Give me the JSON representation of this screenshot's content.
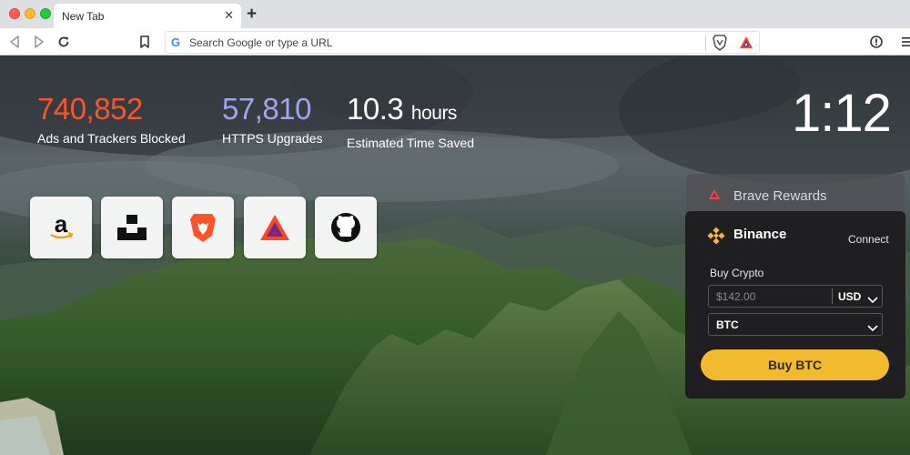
{
  "tab": {
    "title": "New Tab",
    "close": "✕",
    "new_tab": "+"
  },
  "toolbar": {
    "url_placeholder": "Search Google or type a URL",
    "google_glyph": "G"
  },
  "stats": [
    {
      "value": "740,852",
      "label": "Ads and Trackers Blocked",
      "color": "#fb542b"
    },
    {
      "value": "57,810",
      "label": "HTTPS Upgrades",
      "color": "#a0a5eb"
    },
    {
      "value": "10.3",
      "unit": "hours",
      "label": "Estimated Time Saved",
      "color": "#ffffff"
    }
  ],
  "clock": "1:12",
  "top_sites": [
    "amazon-icon",
    "unsplash-icon",
    "brave-lion-icon",
    "bat-triangle-icon",
    "github-icon"
  ],
  "rewards": {
    "title": "Brave Rewards"
  },
  "binance": {
    "title": "Binance",
    "connect": "Connect",
    "buy_label": "Buy Crypto",
    "amount_placeholder": "$142.00",
    "currency": "USD",
    "asset": "BTC",
    "buy_button": "Buy BTC",
    "accent": "#f3ba2f"
  }
}
